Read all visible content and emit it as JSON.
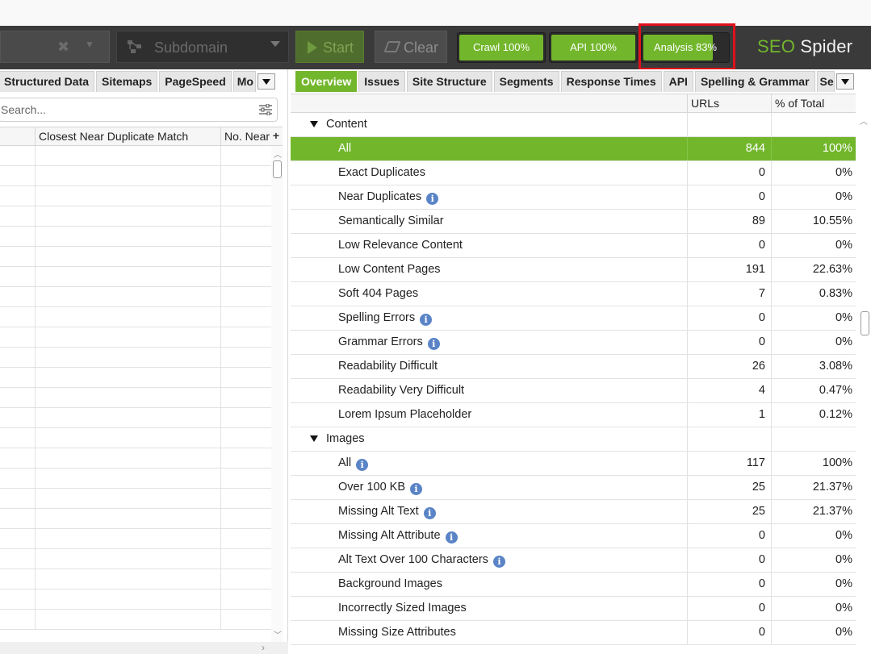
{
  "toolbar": {
    "mode_label": "Subdomain",
    "start_label": "Start",
    "clear_label": "Clear",
    "progress": [
      {
        "label": "Crawl 100%",
        "value": 100
      },
      {
        "label": "API 100%",
        "value": 100
      },
      {
        "label": "Analysis 83%",
        "value": 83
      }
    ],
    "logo_seo": "SEO",
    "logo_spider": "Spider"
  },
  "left": {
    "tabs": [
      "Structured Data",
      "Sitemaps",
      "PageSpeed",
      "Mo"
    ],
    "search_placeholder": "Search...",
    "columns": [
      "Closest Near Duplicate Match",
      "No. Near"
    ]
  },
  "right": {
    "tabs": [
      "Overview",
      "Issues",
      "Site Structure",
      "Segments",
      "Response Times",
      "API",
      "Spelling & Grammar",
      "Se"
    ],
    "columns": [
      "URLs",
      "% of Total"
    ],
    "rows": [
      {
        "name": "Content",
        "section": true
      },
      {
        "name": "All",
        "urls": "844",
        "pct": "100%",
        "selected": true
      },
      {
        "name": "Exact Duplicates",
        "urls": "0",
        "pct": "0%"
      },
      {
        "name": "Near Duplicates",
        "urls": "0",
        "pct": "0%",
        "info": true
      },
      {
        "name": "Semantically Similar",
        "urls": "89",
        "pct": "10.55%"
      },
      {
        "name": "Low Relevance Content",
        "urls": "0",
        "pct": "0%"
      },
      {
        "name": "Low Content Pages",
        "urls": "191",
        "pct": "22.63%"
      },
      {
        "name": "Soft 404 Pages",
        "urls": "7",
        "pct": "0.83%"
      },
      {
        "name": "Spelling Errors",
        "urls": "0",
        "pct": "0%",
        "info": true
      },
      {
        "name": "Grammar Errors",
        "urls": "0",
        "pct": "0%",
        "info": true
      },
      {
        "name": "Readability Difficult",
        "urls": "26",
        "pct": "3.08%"
      },
      {
        "name": "Readability Very Difficult",
        "urls": "4",
        "pct": "0.47%"
      },
      {
        "name": "Lorem Ipsum Placeholder",
        "urls": "1",
        "pct": "0.12%"
      },
      {
        "name": "Images",
        "section": true
      },
      {
        "name": "All",
        "urls": "117",
        "pct": "100%",
        "info": true
      },
      {
        "name": "Over 100 KB",
        "urls": "25",
        "pct": "21.37%",
        "info": true
      },
      {
        "name": "Missing Alt Text",
        "urls": "25",
        "pct": "21.37%",
        "info": true
      },
      {
        "name": "Missing Alt Attribute",
        "urls": "0",
        "pct": "0%",
        "info": true
      },
      {
        "name": "Alt Text Over 100 Characters",
        "urls": "0",
        "pct": "0%",
        "info": true
      },
      {
        "name": "Background Images",
        "urls": "0",
        "pct": "0%"
      },
      {
        "name": "Incorrectly Sized Images",
        "urls": "0",
        "pct": "0%"
      },
      {
        "name": "Missing Size Attributes",
        "urls": "0",
        "pct": "0%"
      }
    ]
  },
  "colors": {
    "accent": "#72b62c",
    "toolbar_bg": "#3a3a3a",
    "highlight": "#e0101a",
    "info_icon": "#5a84c6"
  }
}
